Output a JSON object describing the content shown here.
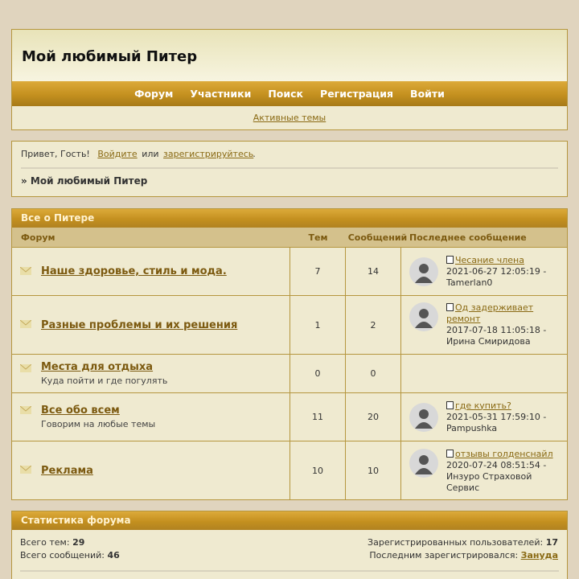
{
  "header": {
    "site_title": "Мой любимый Питер",
    "nav": [
      "Форум",
      "Участники",
      "Поиск",
      "Регистрация",
      "Войти"
    ],
    "subnav_link": "Активные темы"
  },
  "greeting": {
    "hello": "Привет, Гость!",
    "login_link": "Войдите",
    "or": "или",
    "register_link": "зарегистрируйтесь",
    "dot": ".",
    "breadcrumb": "» Мой любимый Питер"
  },
  "forums": {
    "category": "Все о Питере",
    "columns": {
      "forum": "Форум",
      "topics": "Тем",
      "posts": "Сообщений",
      "last": "Последнее сообщение"
    },
    "rows": [
      {
        "name": "Наше здоровье, стиль и мода.",
        "desc": "",
        "topics": "7",
        "posts": "14",
        "last_title": "Чесание члена",
        "last_meta": "2021-06-27 12:05:19 - Tamerlan0"
      },
      {
        "name": "Разные проблемы и их решения",
        "desc": "",
        "topics": "1",
        "posts": "2",
        "last_title": "Од задерживает ремонт",
        "last_meta": "2017-07-18 11:05:18 - Ирина Смиридова"
      },
      {
        "name": "Места для отдыха",
        "desc": "Куда пойти и где погулять",
        "topics": "0",
        "posts": "0",
        "last_title": "",
        "last_meta": ""
      },
      {
        "name": "Все обо всем",
        "desc": "Говорим на любые темы",
        "topics": "11",
        "posts": "20",
        "last_title": "где купить?",
        "last_meta": "2021-05-31 17:59:10 - Pampushka"
      },
      {
        "name": "Реклама",
        "desc": "",
        "topics": "10",
        "posts": "10",
        "last_title": "отзывы голденснайл",
        "last_meta": "2020-07-24 08:51:54 - Инзуро Страховой Сервис"
      }
    ]
  },
  "stats": {
    "title": "Статистика форума",
    "total_topics_label": "Всего тем:",
    "total_topics": "29",
    "total_posts_label": "Всего сообщений:",
    "total_posts": "46",
    "registered_label": "Зарегистрированных пользователей:",
    "registered": "17",
    "last_registered_label": "Последним зарегистрировался:",
    "last_registered": "Зануда"
  }
}
